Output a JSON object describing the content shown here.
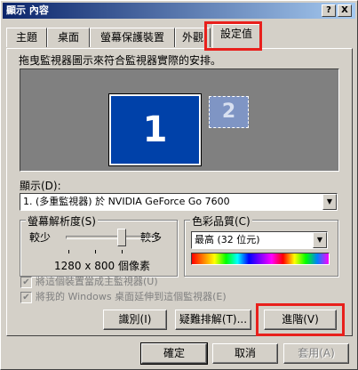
{
  "window": {
    "title": "顯示 內容",
    "help_button": "?",
    "close_button": "X"
  },
  "tabs": [
    {
      "label": "主題"
    },
    {
      "label": "桌面"
    },
    {
      "label": "螢幕保護裝置"
    },
    {
      "label": "外觀"
    },
    {
      "label": "設定值",
      "active": true
    }
  ],
  "instruction": "拖曳監視器圖示來符合監視器實際的安排。",
  "monitors": {
    "primary": "1",
    "secondary": "2"
  },
  "display": {
    "label": "顯示(D):",
    "value": "1. (多重監視器) 於 NVIDIA GeForce Go 7600"
  },
  "resolution": {
    "title": "螢幕解析度(S)",
    "less": "較少",
    "more": "較多",
    "value_text": "1280 x 800 個像素"
  },
  "color_quality": {
    "title": "色彩品質(C)",
    "value": "最高 (32 位元)"
  },
  "checkboxes": [
    {
      "label": "將這個裝置當成主監視器(U)",
      "checked": true,
      "disabled": true
    },
    {
      "label": "將我的 Windows 桌面延伸到這個監視器(E)",
      "checked": true,
      "disabled": true
    }
  ],
  "panel_buttons": {
    "identify": "識別(I)",
    "troubleshoot": "疑難排解(T)...",
    "advanced": "進階(V)"
  },
  "dialog_buttons": {
    "ok": "確定",
    "cancel": "取消",
    "apply": "套用(A)"
  },
  "colors": {
    "highlight": "#e8201c",
    "monitor_primary": "#0041a9",
    "title_bar": "#0a246a"
  }
}
